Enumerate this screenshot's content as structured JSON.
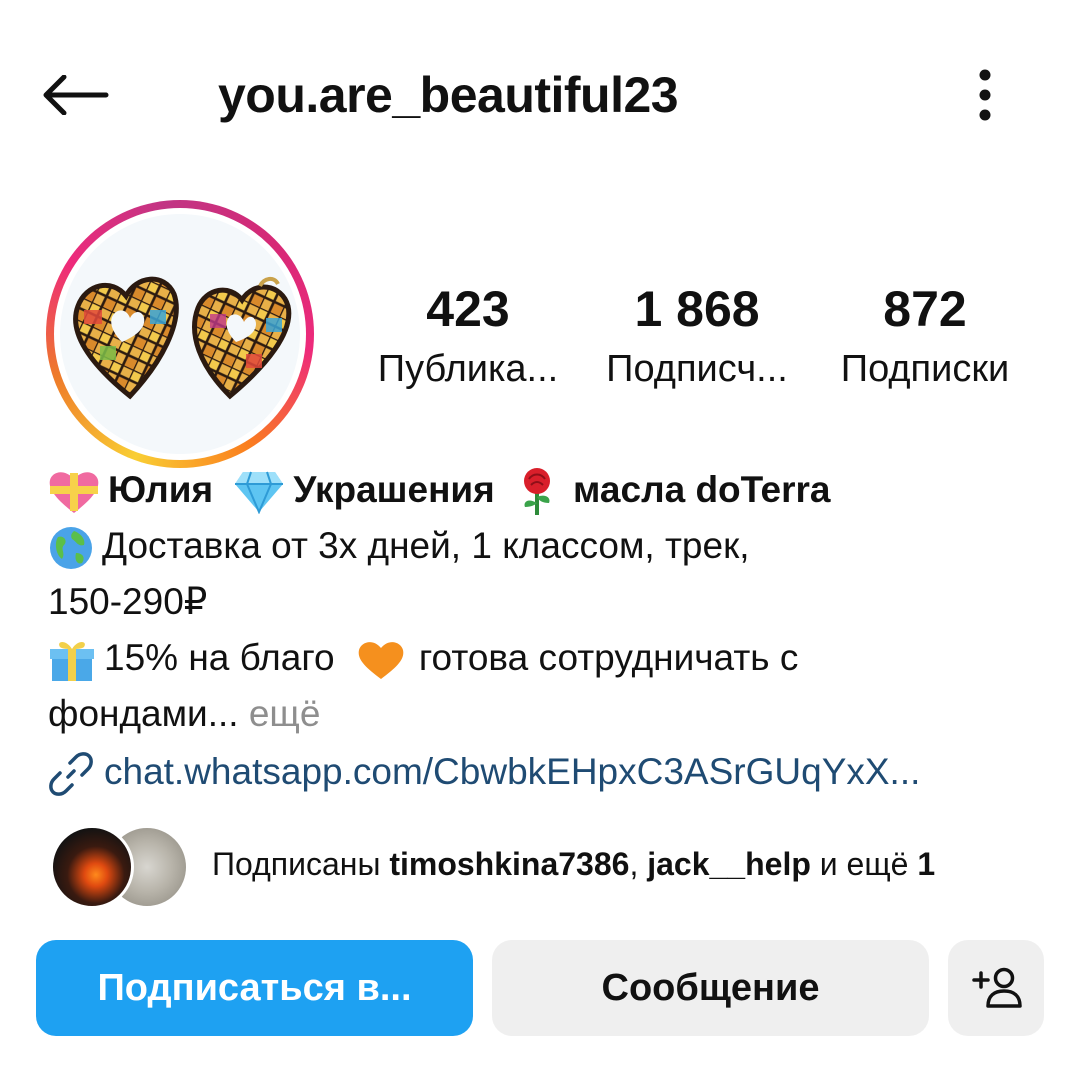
{
  "header": {
    "username": "you.are_beautiful23",
    "back_icon": "arrow-left-icon",
    "more_icon": "kebab-menu-icon"
  },
  "stats": [
    {
      "value": "423",
      "label": "Публика..."
    },
    {
      "value": "1 868",
      "label": "Подписч..."
    },
    {
      "value": "872",
      "label": "Подписки"
    }
  ],
  "bio": {
    "name_parts": [
      "Юлия",
      "Украшения",
      "масла doTerra"
    ],
    "line2": "Доставка от 3х дней, 1 классом, трек,",
    "line3": "150-290₽",
    "line4a": "15% на благо",
    "line4b": "готова сотрудничать с",
    "line5": "фондами...",
    "more": " ещё",
    "link": "chat.whatsapp.com/CbwbkEHpxC3ASrGUqYxX..."
  },
  "followed_by": {
    "prefix": "Подписаны ",
    "user1": "timoshkina7386",
    "sep": ", ",
    "user2": "jack__help",
    "suffix": " и ещё ",
    "count": "1"
  },
  "buttons": {
    "follow": "Подписаться в...",
    "message": "Сообщение",
    "suggest_icon": "add-person-icon"
  },
  "colors": {
    "follow_button": "#1ea1f2",
    "secondary_button": "#efefef",
    "link": "#1f4b73"
  }
}
